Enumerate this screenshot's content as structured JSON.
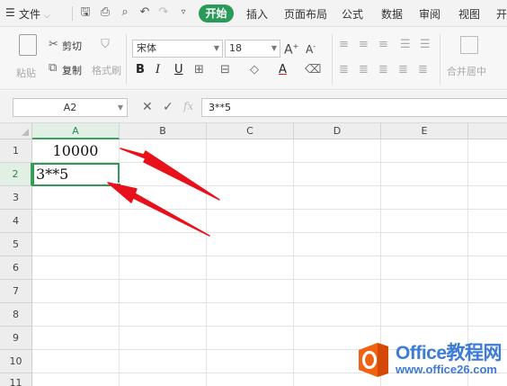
{
  "menubar": {
    "file_menu": "文件",
    "tabs": [
      "开始",
      "插入",
      "页面布局",
      "公式",
      "数据",
      "审阅",
      "视图",
      "开"
    ]
  },
  "ribbon": {
    "paste": "粘贴",
    "cut": "剪切",
    "copy": "复制",
    "format_painter": "格式刷",
    "font_name": "宋体",
    "font_size": "18",
    "bold": "B",
    "italic": "I",
    "underline": "U",
    "font_color_letter": "A",
    "merge_center": "合并居中"
  },
  "formula_bar": {
    "name_box": "A2",
    "fx_label": "fx",
    "formula": "3**5"
  },
  "sheet": {
    "columns": [
      "A",
      "B",
      "C",
      "D",
      "E"
    ],
    "rows": [
      "1",
      "2",
      "3",
      "4",
      "5",
      "6",
      "7",
      "8",
      "9",
      "10",
      "11"
    ],
    "cells": {
      "A1": "10000",
      "A2": "3**5"
    },
    "selected_cell": "A2"
  },
  "watermark": {
    "title": "Office教程网",
    "url": "www.office26.com"
  },
  "colors": {
    "accent_green": "#2a9a5a",
    "arrow_red": "#e8101a",
    "watermark_orange": "#f0620f",
    "watermark_blue": "#3c7bd6"
  }
}
